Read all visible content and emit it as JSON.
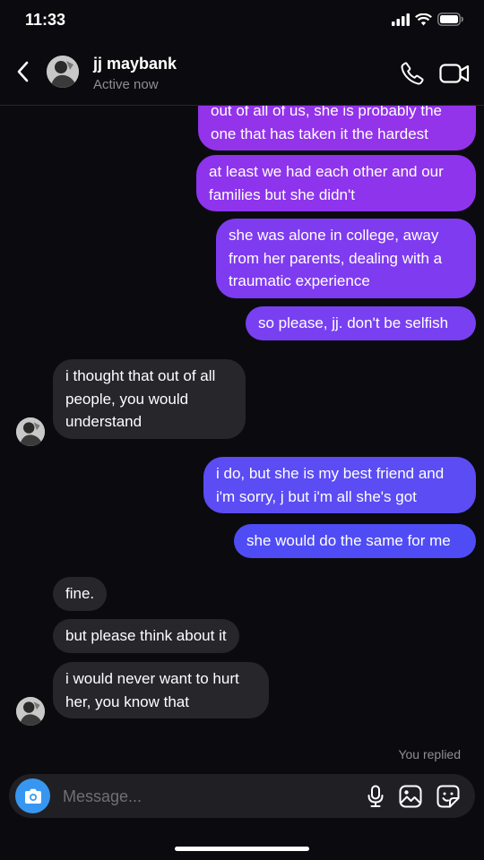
{
  "status_bar": {
    "time": "11:33"
  },
  "header": {
    "name": "jj maybank",
    "status": "Active now"
  },
  "messages": [
    {
      "text": "out of all of us, she is probably the one that has taken it the hardest"
    },
    {
      "text": "at least we had each other and our families but she didn't"
    },
    {
      "text": "she was alone in college, away from her parents, dealing with a traumatic experience"
    },
    {
      "text": "so please, jj. don't be selfish"
    },
    {
      "text": "i thought that out of all people, you would understand"
    },
    {
      "text": "i do, but she is my best friend and i'm sorry, j but i'm all she's got"
    },
    {
      "text": "she would do the same for me"
    },
    {
      "text": "fine."
    },
    {
      "text": "but please think about it"
    },
    {
      "text": "i would never want to hurt her, you know that"
    }
  ],
  "replied_label": "You replied",
  "composer": {
    "placeholder": "Message..."
  },
  "colors": {
    "sent_top": "#9333ea",
    "sent_bottom": "#4f4cf5",
    "received": "#26262b",
    "camera": "#3797f0"
  }
}
